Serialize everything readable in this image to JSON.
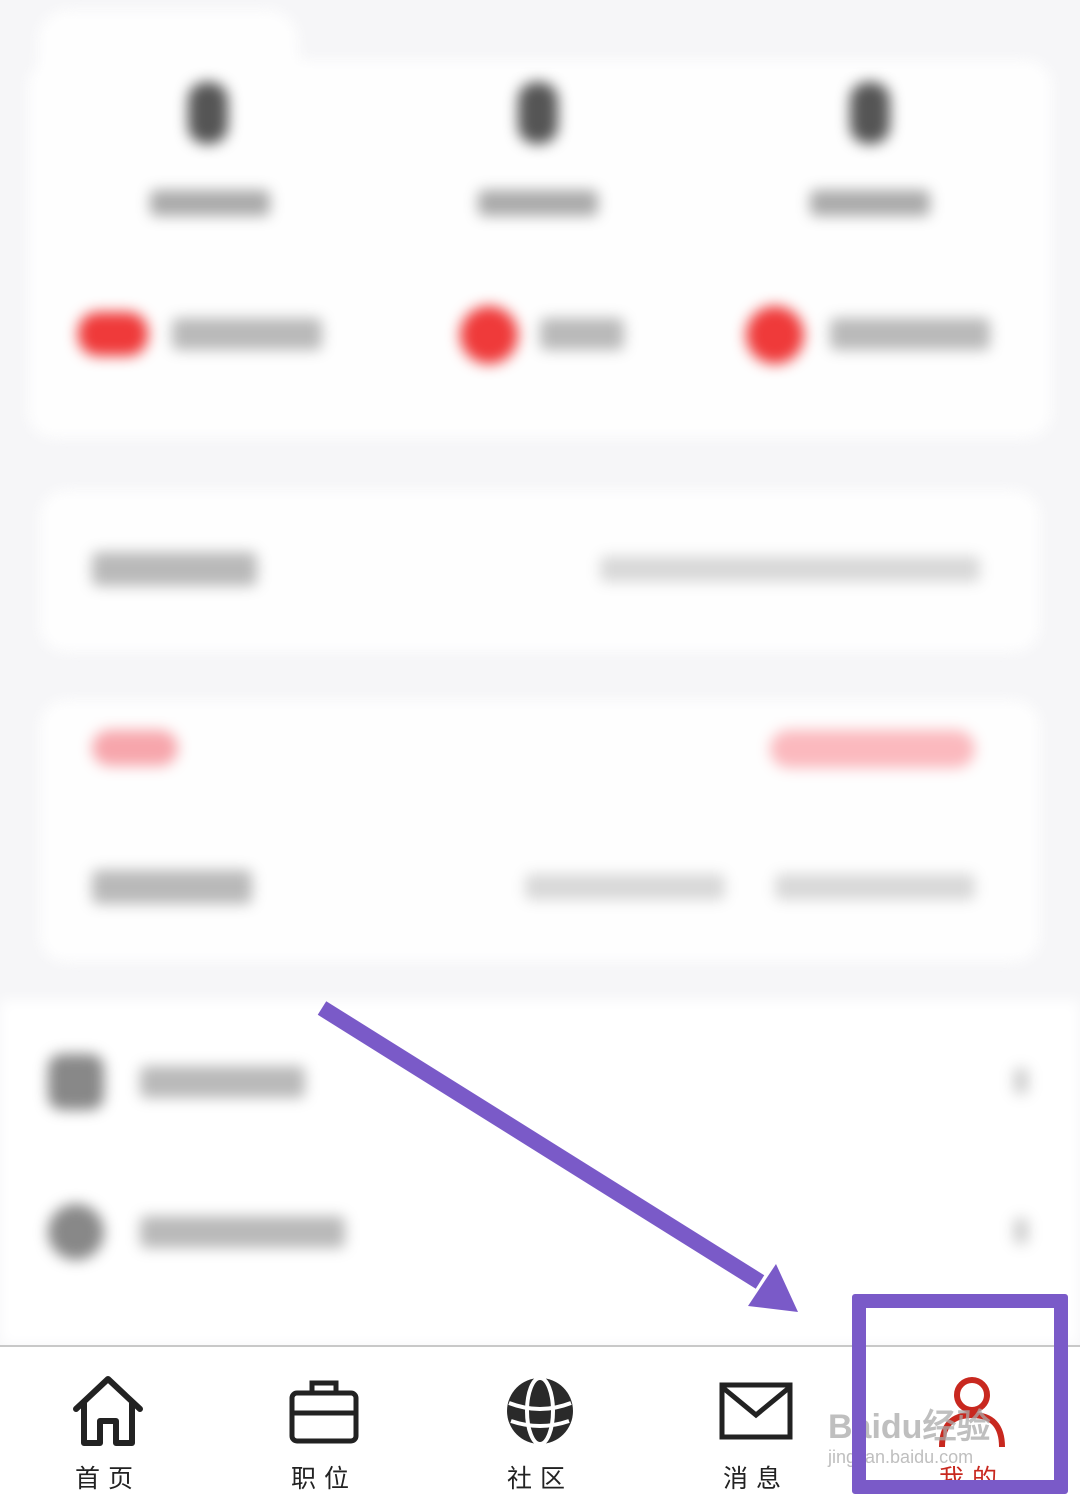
{
  "tabbar": {
    "items": [
      {
        "label": "首页",
        "icon": "home-icon"
      },
      {
        "label": "职位",
        "icon": "briefcase-icon"
      },
      {
        "label": "社区",
        "icon": "globe-icon"
      },
      {
        "label": "消息",
        "icon": "mail-icon"
      },
      {
        "label": "我的",
        "icon": "user-icon",
        "active": true
      }
    ]
  },
  "watermark": {
    "main": "Baidu经验",
    "sub": "jingyan.baidu.com"
  },
  "annotation": {
    "color": "#7a5ac8"
  },
  "colors": {
    "active_tab": "#c8281f",
    "badge_red": "#ef3a3a"
  }
}
